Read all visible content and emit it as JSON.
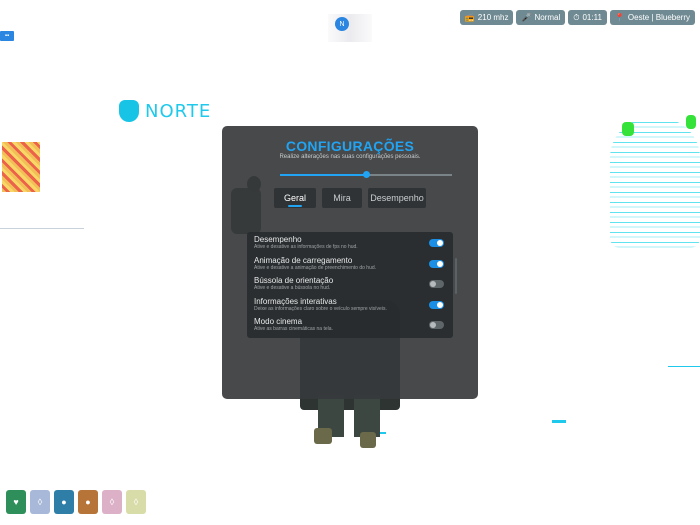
{
  "status": {
    "items": [
      {
        "icon": "radio-icon",
        "glyph": "📻",
        "text": "210 mhz"
      },
      {
        "icon": "microphone-icon",
        "glyph": "🎤",
        "text": "Normal"
      },
      {
        "icon": "clock-icon",
        "glyph": "⏱",
        "text": "01:11"
      },
      {
        "icon": "location-pin-icon",
        "glyph": "📍",
        "text": "Oeste | Blueberry"
      }
    ]
  },
  "brand": {
    "name": "NORTE"
  },
  "settings": {
    "title": "CONFIGURAÇÕES",
    "subtitle": "Realize alterações nas suas configurações pessoais.",
    "slider_value": 0.5,
    "tabs": [
      {
        "label": "Geral",
        "active": true
      },
      {
        "label": "Mira",
        "active": false
      },
      {
        "label": "Desempenho",
        "active": false
      }
    ],
    "options": [
      {
        "title": "Desempenho",
        "desc": "Ative e desative as informações de fps no hud.",
        "enabled": true
      },
      {
        "title": "Animação de carregamento",
        "desc": "Ative e desative a animação de preenchimento do hud.",
        "enabled": true
      },
      {
        "title": "Bússola de orientação",
        "desc": "Ative e desative a bússola no hud.",
        "enabled": false
      },
      {
        "title": "Informações interativas",
        "desc": "Deixe as informações claro sobre o veículo sempre visíveis.",
        "enabled": true
      },
      {
        "title": "Modo cinema",
        "desc": "Ative as barras cinemáticas na tela.",
        "enabled": false
      }
    ]
  },
  "hotbar": {
    "cards": [
      {
        "icon": "heart-icon",
        "glyph": "♥",
        "color": "#2f8f5a"
      },
      {
        "icon": "shield-icon",
        "glyph": "◊",
        "color": "#a7b8d8"
      },
      {
        "icon": "water-drop-icon",
        "glyph": "●",
        "color": "#2e7ea8"
      },
      {
        "icon": "food-icon",
        "glyph": "●",
        "color": "#b77438"
      },
      {
        "icon": "stress-icon",
        "glyph": "◊",
        "color": "#dcb1c8"
      },
      {
        "icon": "stamina-icon",
        "glyph": "◊",
        "color": "#d8dca8"
      }
    ]
  },
  "colors": {
    "accent": "#20a4f3",
    "brand": "#1ec9ec"
  }
}
